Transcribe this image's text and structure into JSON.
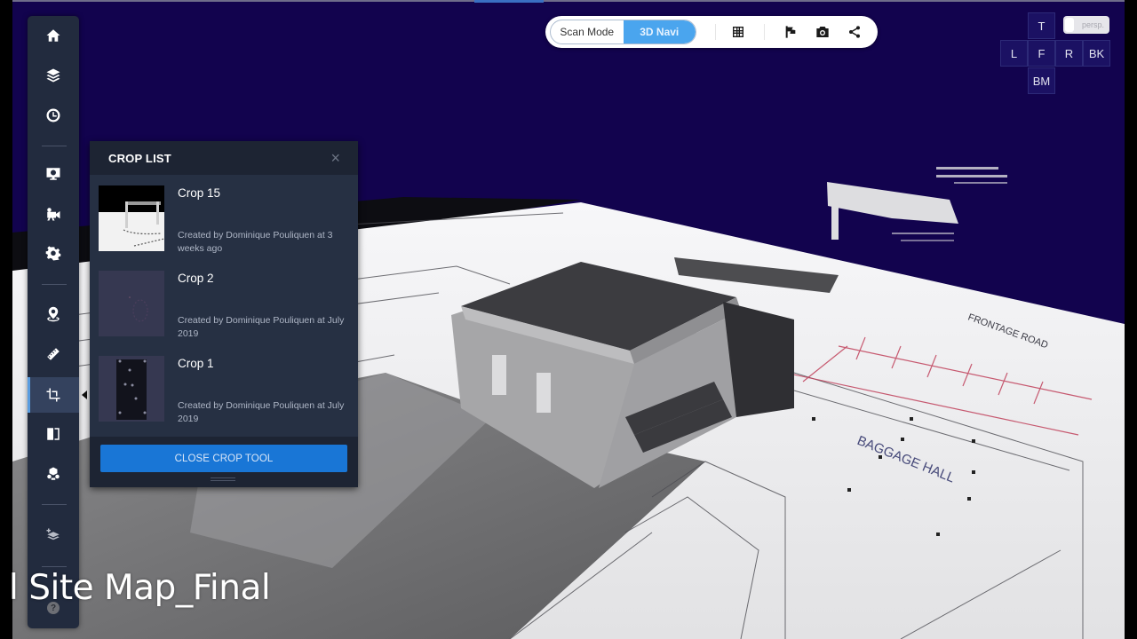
{
  "toolbar": {
    "modes": [
      {
        "label": "Scan Mode",
        "active": false
      },
      {
        "label": "3D Navi",
        "active": true
      }
    ],
    "icons": [
      "grid-icon",
      "flag-icon",
      "camera-icon",
      "share-icon"
    ]
  },
  "view_cube": {
    "top": "T",
    "left": "L",
    "front": "F",
    "right": "R",
    "back": "BK",
    "bottom": "BM",
    "projection_label": "persp."
  },
  "sidebar": {
    "items": [
      {
        "name": "home",
        "icon": "home-icon"
      },
      {
        "name": "layers",
        "icon": "layers-icon"
      },
      {
        "name": "history",
        "icon": "clock-icon"
      },
      {
        "name": "display-settings",
        "icon": "monitor-gear-icon"
      },
      {
        "name": "video",
        "icon": "video-camera-icon"
      },
      {
        "name": "settings",
        "icon": "gear-icon"
      },
      {
        "name": "location",
        "icon": "map-pin-icon"
      },
      {
        "name": "measure",
        "icon": "ruler-icon"
      },
      {
        "name": "crop",
        "icon": "crop-icon",
        "active": true
      },
      {
        "name": "compare",
        "icon": "split-view-icon"
      },
      {
        "name": "objects",
        "icon": "cubes-icon"
      },
      {
        "name": "add-layer",
        "icon": "layers-plus-icon"
      }
    ],
    "help_label": "?"
  },
  "crop_panel": {
    "title": "CROP LIST",
    "close_glyph": "×",
    "items": [
      {
        "name": "Crop 15",
        "meta": "Created by Dominique Pouliquen at 3 weeks ago"
      },
      {
        "name": "Crop 2",
        "meta": "Created by Dominique Pouliquen at July 2019"
      },
      {
        "name": "Crop 1",
        "meta": "Created by Dominique Pouliquen at July 2019"
      }
    ],
    "close_button_label": "CLOSE CROP TOOL"
  },
  "scene": {
    "labels": [
      "FRONTAGE ROAD",
      "BAGGAGE HALL"
    ],
    "colors": {
      "sky": "#12034e",
      "plan": "#f4f4f6",
      "accent_red": "#c0405a"
    }
  },
  "caption": {
    "text": "l Site Map_Final"
  }
}
